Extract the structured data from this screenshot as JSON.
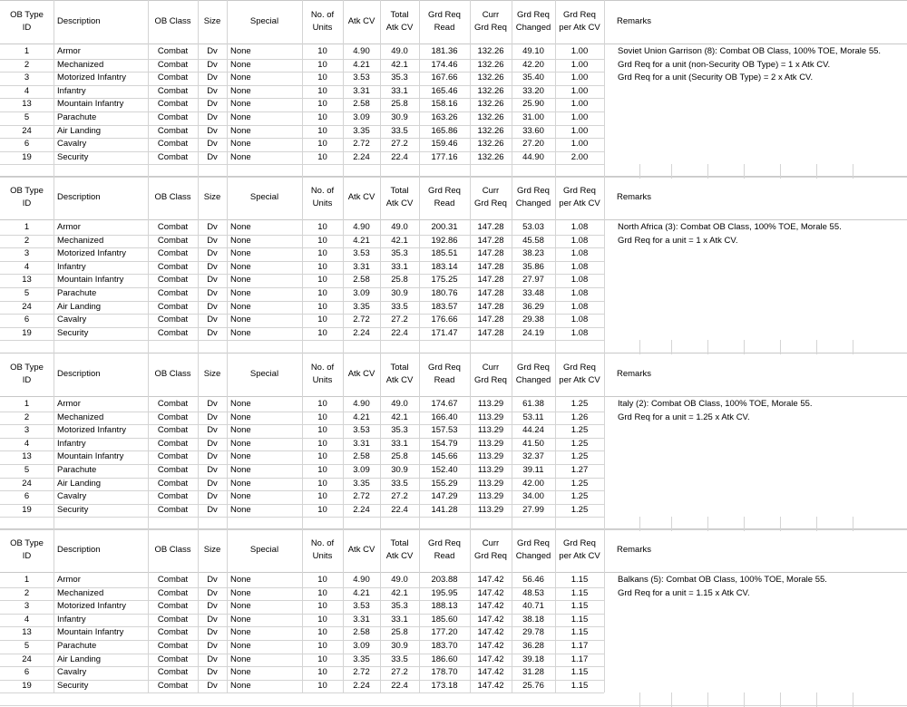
{
  "headers": [
    "OB Type ID",
    "Description",
    "OB Class",
    "Size",
    "Special",
    "No. of Units",
    "Atk CV",
    "Total Atk CV",
    "Grd Req Read",
    "Curr Grd Req",
    "Grd Req Changed",
    "Grd Req per Atk CV",
    "Remarks"
  ],
  "headers_lines": [
    [
      "OB Type",
      "ID"
    ],
    [
      "Description"
    ],
    [
      "OB Class"
    ],
    [
      "Size"
    ],
    [
      "Special"
    ],
    [
      "No. of",
      "Units"
    ],
    [
      "Atk CV"
    ],
    [
      "Total",
      "Atk CV"
    ],
    [
      "Grd Req",
      "Read"
    ],
    [
      "Curr",
      "Grd Req"
    ],
    [
      "Grd Req",
      "Changed"
    ],
    [
      "Grd Req",
      "per Atk CV"
    ],
    [
      "Remarks"
    ]
  ],
  "blocks": [
    {
      "rows": [
        [
          "1",
          "Armor",
          "Combat",
          "Dv",
          "None",
          "10",
          "4.90",
          "49.0",
          "181.36",
          "132.26",
          "49.10",
          "1.00"
        ],
        [
          "2",
          "Mechanized",
          "Combat",
          "Dv",
          "None",
          "10",
          "4.21",
          "42.1",
          "174.46",
          "132.26",
          "42.20",
          "1.00"
        ],
        [
          "3",
          "Motorized Infantry",
          "Combat",
          "Dv",
          "None",
          "10",
          "3.53",
          "35.3",
          "167.66",
          "132.26",
          "35.40",
          "1.00"
        ],
        [
          "4",
          "Infantry",
          "Combat",
          "Dv",
          "None",
          "10",
          "3.31",
          "33.1",
          "165.46",
          "132.26",
          "33.20",
          "1.00"
        ],
        [
          "13",
          "Mountain Infantry",
          "Combat",
          "Dv",
          "None",
          "10",
          "2.58",
          "25.8",
          "158.16",
          "132.26",
          "25.90",
          "1.00"
        ],
        [
          "5",
          "Parachute",
          "Combat",
          "Dv",
          "None",
          "10",
          "3.09",
          "30.9",
          "163.26",
          "132.26",
          "31.00",
          "1.00"
        ],
        [
          "24",
          "Air Landing",
          "Combat",
          "Dv",
          "None",
          "10",
          "3.35",
          "33.5",
          "165.86",
          "132.26",
          "33.60",
          "1.00"
        ],
        [
          "6",
          "Cavalry",
          "Combat",
          "Dv",
          "None",
          "10",
          "2.72",
          "27.2",
          "159.46",
          "132.26",
          "27.20",
          "1.00"
        ],
        [
          "19",
          "Security",
          "Combat",
          "Dv",
          "None",
          "10",
          "2.24",
          "22.4",
          "177.16",
          "132.26",
          "44.90",
          "2.00"
        ]
      ],
      "remarks": [
        "Soviet Union Garrison (8): Combat OB Class, 100% TOE, Morale 55.",
        "Grd Req for a unit (non-Security OB Type) = 1 x Atk CV.",
        "Grd Req for a unit (Security OB Type) = 2 x Atk CV."
      ]
    },
    {
      "rows": [
        [
          "1",
          "Armor",
          "Combat",
          "Dv",
          "None",
          "10",
          "4.90",
          "49.0",
          "200.31",
          "147.28",
          "53.03",
          "1.08"
        ],
        [
          "2",
          "Mechanized",
          "Combat",
          "Dv",
          "None",
          "10",
          "4.21",
          "42.1",
          "192.86",
          "147.28",
          "45.58",
          "1.08"
        ],
        [
          "3",
          "Motorized Infantry",
          "Combat",
          "Dv",
          "None",
          "10",
          "3.53",
          "35.3",
          "185.51",
          "147.28",
          "38.23",
          "1.08"
        ],
        [
          "4",
          "Infantry",
          "Combat",
          "Dv",
          "None",
          "10",
          "3.31",
          "33.1",
          "183.14",
          "147.28",
          "35.86",
          "1.08"
        ],
        [
          "13",
          "Mountain Infantry",
          "Combat",
          "Dv",
          "None",
          "10",
          "2.58",
          "25.8",
          "175.25",
          "147.28",
          "27.97",
          "1.08"
        ],
        [
          "5",
          "Parachute",
          "Combat",
          "Dv",
          "None",
          "10",
          "3.09",
          "30.9",
          "180.76",
          "147.28",
          "33.48",
          "1.08"
        ],
        [
          "24",
          "Air Landing",
          "Combat",
          "Dv",
          "None",
          "10",
          "3.35",
          "33.5",
          "183.57",
          "147.28",
          "36.29",
          "1.08"
        ],
        [
          "6",
          "Cavalry",
          "Combat",
          "Dv",
          "None",
          "10",
          "2.72",
          "27.2",
          "176.66",
          "147.28",
          "29.38",
          "1.08"
        ],
        [
          "19",
          "Security",
          "Combat",
          "Dv",
          "None",
          "10",
          "2.24",
          "22.4",
          "171.47",
          "147.28",
          "24.19",
          "1.08"
        ]
      ],
      "remarks": [
        "North Africa (3): Combat OB Class, 100% TOE, Morale 55.",
        "Grd Req for a unit = 1 x Atk CV."
      ]
    },
    {
      "rows": [
        [
          "1",
          "Armor",
          "Combat",
          "Dv",
          "None",
          "10",
          "4.90",
          "49.0",
          "174.67",
          "113.29",
          "61.38",
          "1.25"
        ],
        [
          "2",
          "Mechanized",
          "Combat",
          "Dv",
          "None",
          "10",
          "4.21",
          "42.1",
          "166.40",
          "113.29",
          "53.11",
          "1.26"
        ],
        [
          "3",
          "Motorized Infantry",
          "Combat",
          "Dv",
          "None",
          "10",
          "3.53",
          "35.3",
          "157.53",
          "113.29",
          "44.24",
          "1.25"
        ],
        [
          "4",
          "Infantry",
          "Combat",
          "Dv",
          "None",
          "10",
          "3.31",
          "33.1",
          "154.79",
          "113.29",
          "41.50",
          "1.25"
        ],
        [
          "13",
          "Mountain Infantry",
          "Combat",
          "Dv",
          "None",
          "10",
          "2.58",
          "25.8",
          "145.66",
          "113.29",
          "32.37",
          "1.25"
        ],
        [
          "5",
          "Parachute",
          "Combat",
          "Dv",
          "None",
          "10",
          "3.09",
          "30.9",
          "152.40",
          "113.29",
          "39.11",
          "1.27"
        ],
        [
          "24",
          "Air Landing",
          "Combat",
          "Dv",
          "None",
          "10",
          "3.35",
          "33.5",
          "155.29",
          "113.29",
          "42.00",
          "1.25"
        ],
        [
          "6",
          "Cavalry",
          "Combat",
          "Dv",
          "None",
          "10",
          "2.72",
          "27.2",
          "147.29",
          "113.29",
          "34.00",
          "1.25"
        ],
        [
          "19",
          "Security",
          "Combat",
          "Dv",
          "None",
          "10",
          "2.24",
          "22.4",
          "141.28",
          "113.29",
          "27.99",
          "1.25"
        ]
      ],
      "remarks": [
        "Italy (2): Combat OB Class, 100% TOE, Morale 55.",
        "Grd Req for a unit = 1.25 x Atk CV."
      ]
    },
    {
      "rows": [
        [
          "1",
          "Armor",
          "Combat",
          "Dv",
          "None",
          "10",
          "4.90",
          "49.0",
          "203.88",
          "147.42",
          "56.46",
          "1.15"
        ],
        [
          "2",
          "Mechanized",
          "Combat",
          "Dv",
          "None",
          "10",
          "4.21",
          "42.1",
          "195.95",
          "147.42",
          "48.53",
          "1.15"
        ],
        [
          "3",
          "Motorized Infantry",
          "Combat",
          "Dv",
          "None",
          "10",
          "3.53",
          "35.3",
          "188.13",
          "147.42",
          "40.71",
          "1.15"
        ],
        [
          "4",
          "Infantry",
          "Combat",
          "Dv",
          "None",
          "10",
          "3.31",
          "33.1",
          "185.60",
          "147.42",
          "38.18",
          "1.15"
        ],
        [
          "13",
          "Mountain Infantry",
          "Combat",
          "Dv",
          "None",
          "10",
          "2.58",
          "25.8",
          "177.20",
          "147.42",
          "29.78",
          "1.15"
        ],
        [
          "5",
          "Parachute",
          "Combat",
          "Dv",
          "None",
          "10",
          "3.09",
          "30.9",
          "183.70",
          "147.42",
          "36.28",
          "1.17"
        ],
        [
          "24",
          "Air Landing",
          "Combat",
          "Dv",
          "None",
          "10",
          "3.35",
          "33.5",
          "186.60",
          "147.42",
          "39.18",
          "1.17"
        ],
        [
          "6",
          "Cavalry",
          "Combat",
          "Dv",
          "None",
          "10",
          "2.72",
          "27.2",
          "178.70",
          "147.42",
          "31.28",
          "1.15"
        ],
        [
          "19",
          "Security",
          "Combat",
          "Dv",
          "None",
          "10",
          "2.24",
          "22.4",
          "173.18",
          "147.42",
          "25.76",
          "1.15"
        ]
      ],
      "remarks": [
        "Balkans (5): Combat OB Class, 100% TOE, Morale 55.",
        "Grd Req for a unit = 1.15 x Atk CV."
      ]
    }
  ]
}
